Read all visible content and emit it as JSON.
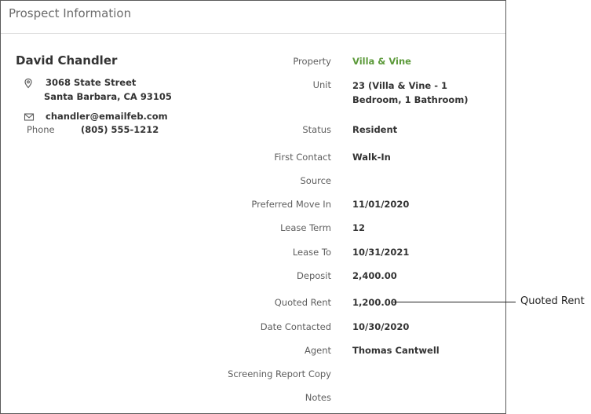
{
  "panel": {
    "title": "Prospect Information"
  },
  "prospect": {
    "name": "David Chandler",
    "address_line1": "3068 State Street",
    "address_line2": "Santa Barbara, CA 93105",
    "email": "chandler@emailfeb.com",
    "phone_label": "Phone",
    "phone": "(805) 555-1212"
  },
  "details": {
    "property_label": "Property",
    "property": "Villa & Vine",
    "unit_label": "Unit",
    "unit": "23 (Villa & Vine - 1 Bedroom, 1 Bathroom)",
    "status_label": "Status",
    "status": "Resident",
    "first_contact_label": "First Contact",
    "first_contact": "Walk-In",
    "source_label": "Source",
    "source": "",
    "preferred_move_in_label": "Preferred Move In",
    "preferred_move_in": "11/01/2020",
    "lease_term_label": "Lease Term",
    "lease_term": "12",
    "lease_to_label": "Lease To",
    "lease_to": "10/31/2021",
    "deposit_label": "Deposit",
    "deposit": "2,400.00",
    "quoted_rent_label": "Quoted Rent",
    "quoted_rent": "1,200.00",
    "date_contacted_label": "Date Contacted",
    "date_contacted": "10/30/2020",
    "agent_label": "Agent",
    "agent": "Thomas Cantwell",
    "screening_report_label": "Screening Report Copy",
    "screening_report": "",
    "notes_label": "Notes",
    "notes": ""
  },
  "callout": {
    "text": "Quoted Rent"
  },
  "icons": {
    "address": "map-pin-icon",
    "email": "envelope-icon"
  },
  "colors": {
    "property_link": "#5c9a3a",
    "border": "#5a5a5a"
  }
}
